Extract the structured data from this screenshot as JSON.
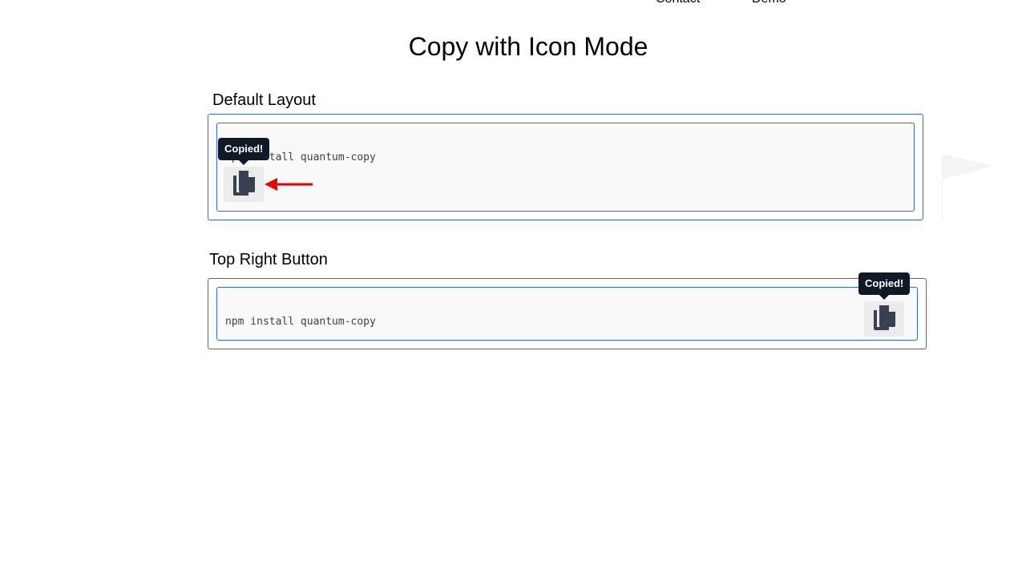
{
  "nav": {
    "contact_label": "Contact",
    "demo_label": "Demo"
  },
  "page": {
    "title": "Copy with Icon Mode"
  },
  "sections": [
    {
      "heading": "Default Layout",
      "code": "npm install quantum-copy",
      "tooltip": "Copied!",
      "copy_icon": "copy-icon"
    },
    {
      "heading": "Top Right Button",
      "code": "npm install quantum-copy",
      "tooltip": "Copied!",
      "copy_icon": "copy-icon"
    }
  ],
  "colors": {
    "border": "#3b6ab8",
    "code_background": "#f9f9f9",
    "button_background": "#ebebeb",
    "tooltip_background": "#111827",
    "icon": "#374151",
    "annotation_arrow": "#ee0000"
  }
}
